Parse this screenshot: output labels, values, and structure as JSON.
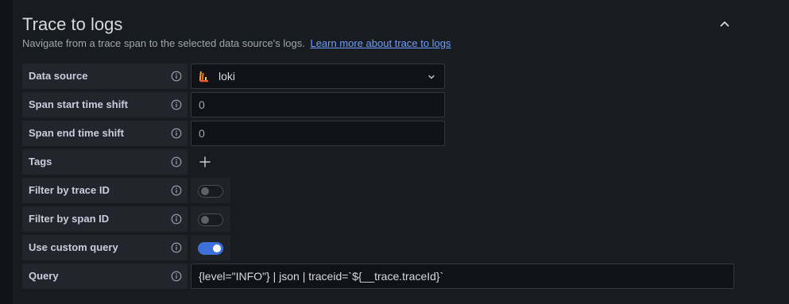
{
  "section": {
    "title": "Trace to logs",
    "description": "Navigate from a trace span to the selected data source's logs.",
    "learn_more": "Learn more about trace to logs"
  },
  "fields": {
    "data_source": {
      "label": "Data source",
      "value": "loki",
      "icon": "loki-logo-icon"
    },
    "span_start": {
      "label": "Span start time shift",
      "value": "0"
    },
    "span_end": {
      "label": "Span end time shift",
      "value": "0"
    },
    "tags": {
      "label": "Tags"
    },
    "filter_trace": {
      "label": "Filter by trace ID",
      "enabled": false
    },
    "filter_span": {
      "label": "Filter by span ID",
      "enabled": false
    },
    "custom_query": {
      "label": "Use custom query",
      "enabled": true
    },
    "query": {
      "label": "Query",
      "value": "{level=\"INFO\"} | json | traceid=`${__trace.traceId}`"
    }
  },
  "colors": {
    "background": "#111217",
    "panel": "#181b1f",
    "label_bg": "#22252b",
    "link": "#6e9fff",
    "toggle_on": "#3d71d9"
  }
}
